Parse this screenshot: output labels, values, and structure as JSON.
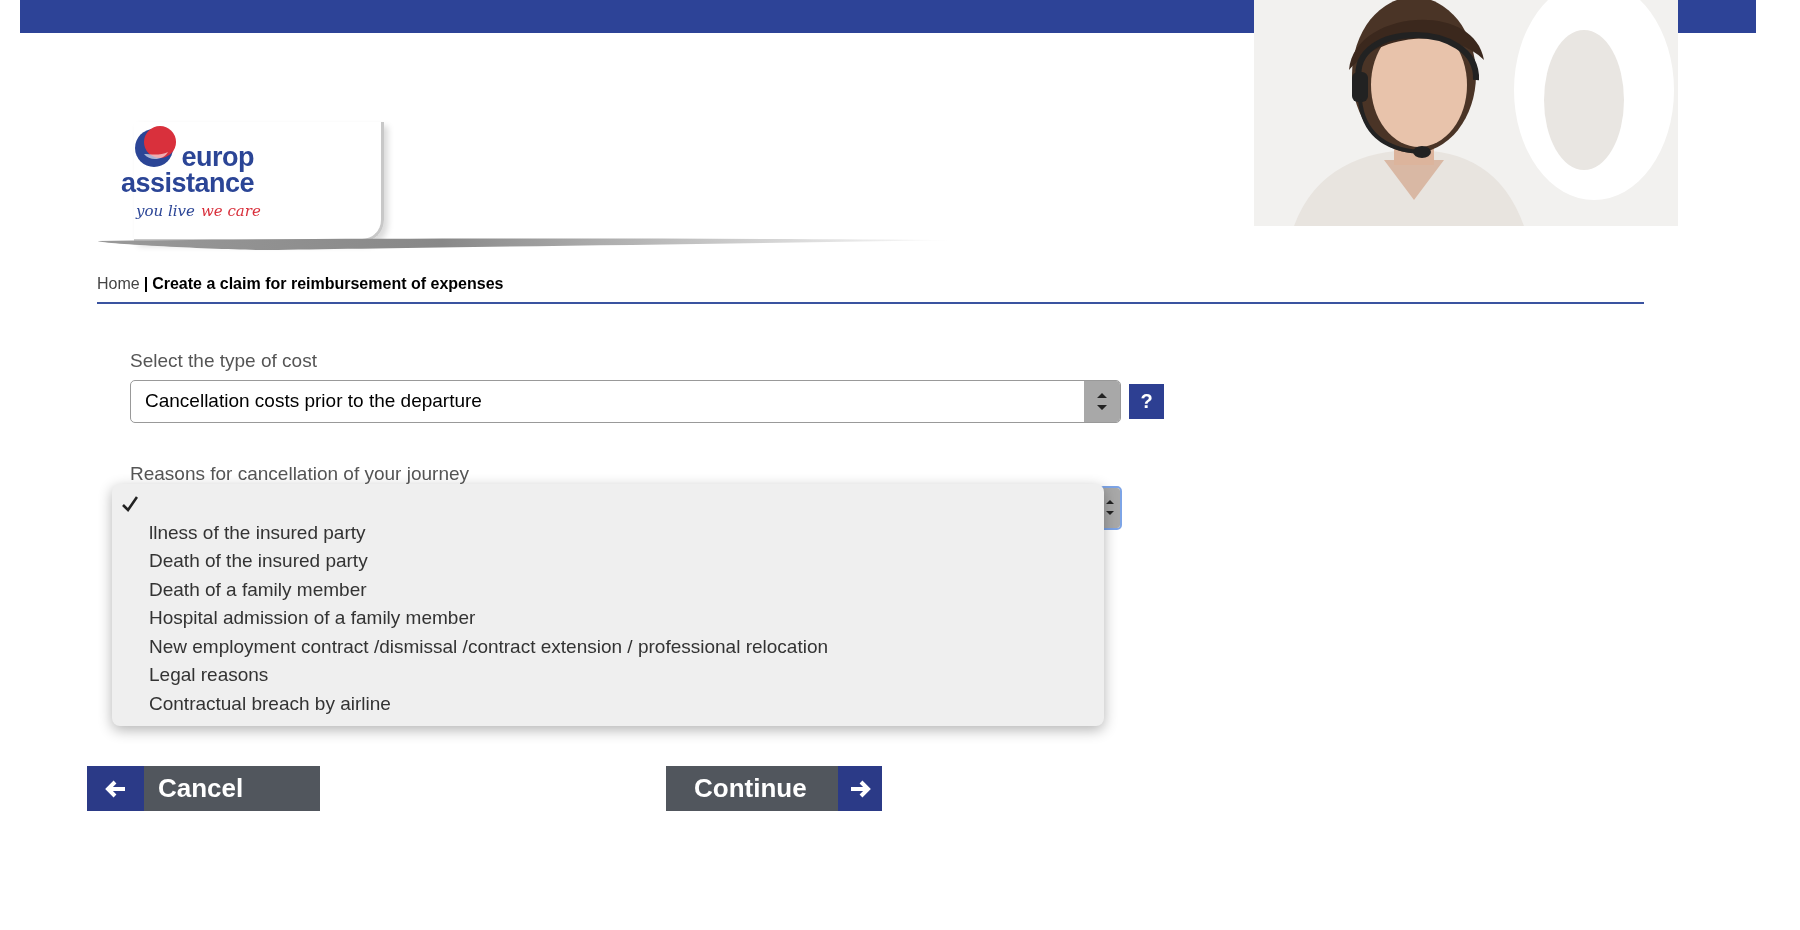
{
  "logo": {
    "lines": [
      "europ",
      "assistance"
    ],
    "tagline": [
      "you live",
      "we care"
    ]
  },
  "breadcrumb": {
    "home": "Home",
    "separator": "|",
    "current": "Create a claim for reimbursement of expenses"
  },
  "cost_type": {
    "label": "Select the type of cost",
    "value": "Cancellation costs prior to the departure",
    "help": "?"
  },
  "reasons": {
    "label": "Reasons for cancellation of your journey",
    "expanded": true,
    "options": [
      {
        "selected": true
      },
      {
        "label": "llness of the insured party",
        "selected": false
      },
      {
        "label": "Death of the insured party",
        "selected": false
      },
      {
        "label": "Death of a family member",
        "selected": false
      },
      {
        "label": "Hospital admission of a family member",
        "selected": false
      },
      {
        "label": "New employment contract /dismissal /contract extension / professional relocation",
        "selected": false
      },
      {
        "label": "Legal reasons",
        "selected": false
      },
      {
        "label": "Contractual breach by airline",
        "selected": false
      }
    ]
  },
  "buttons": [
    {
      "kind": "back",
      "label": "Cancel"
    },
    {
      "kind": "next",
      "label": "Continue"
    }
  ]
}
